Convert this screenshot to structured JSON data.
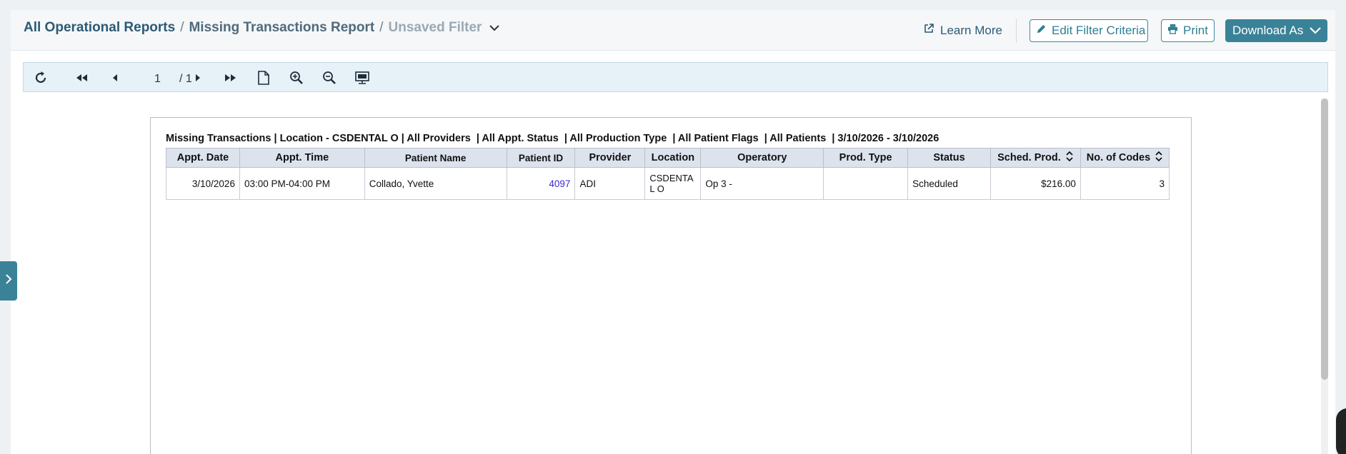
{
  "breadcrumb": {
    "root": "All Operational Reports",
    "sep1": "/",
    "report": "Missing Transactions Report",
    "sep2": "/",
    "filter": "Unsaved Filter"
  },
  "header_actions": {
    "learn_more": "Learn More",
    "edit_filter": "Edit Filter Criteria",
    "print": "Print",
    "download": "Download As"
  },
  "toolbar": {
    "page_current": "1",
    "page_total": "/ 1",
    "icons": [
      "refresh-icon",
      "first-page-icon",
      "prev-page-icon",
      "next-page-icon",
      "last-page-icon",
      "page-view-icon",
      "zoom-in-icon",
      "zoom-out-icon",
      "presentation-icon"
    ]
  },
  "report": {
    "title": "Missing Transactions | Location - CSDENTAL O | All Providers  | All Appt. Status  | All Production Type  | All Patient Flags  | All Patients  | 3/10/2026 - 3/10/2026",
    "columns": [
      "Appt. Date",
      "Appt. Time",
      "Patient Name",
      "Patient ID",
      "Provider",
      "Location",
      "Operatory",
      "Prod. Type",
      "Status",
      "Sched. Prod.",
      "No. of Codes"
    ],
    "rows": [
      {
        "appt_date": "3/10/2026",
        "appt_time": "03:00 PM-04:00 PM",
        "patient_name": "Collado, Yvette",
        "patient_id": "4097",
        "provider": "ADI",
        "location": "CSDENTA L O",
        "operatory": "Op 3 -",
        "prod_type": "",
        "status": "Scheduled",
        "sched_prod": "$216.00",
        "no_of_codes": "3"
      }
    ]
  },
  "colors": {
    "brand": "#3a8297",
    "breadcrumb": "#2c5a74",
    "link": "#3b2bd6"
  }
}
